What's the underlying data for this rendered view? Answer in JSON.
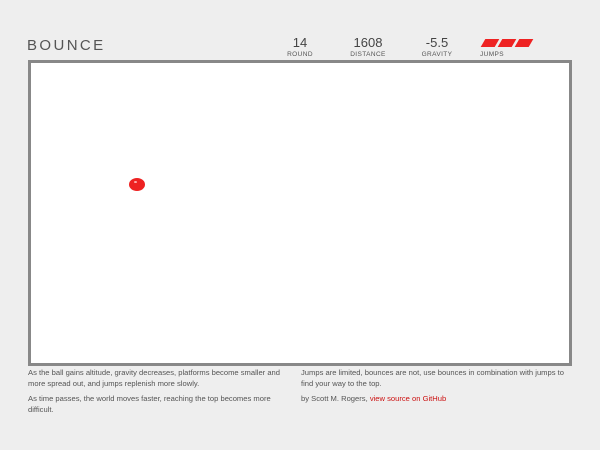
{
  "header": {
    "title": "BOUNCE"
  },
  "stats": {
    "round": {
      "value": "14",
      "label": "ROUND"
    },
    "distance": {
      "value": "1608",
      "label": "DISTANCE"
    },
    "gravity": {
      "value": "-5.5",
      "label": "GRAVITY"
    },
    "jumps": {
      "remaining": 3,
      "label": "JUMPS",
      "color": "#ee2222"
    }
  },
  "game": {
    "ball_color": "#ee2222",
    "border_color": "#888888"
  },
  "footer": {
    "left": [
      "As the ball gains altitude, gravity decreases, platforms become smaller and more spread out, and jumps replenish more slowly.",
      "As time passes, the world moves faster, reaching the top becomes more difficult."
    ],
    "right_1": "Jumps are limited, bounces are not, use bounces in combination with jumps to find your way to the top.",
    "credit": "by Scott M. Rogers,",
    "link_text": "view source on GitHub",
    "link_color": "#cc1111"
  }
}
